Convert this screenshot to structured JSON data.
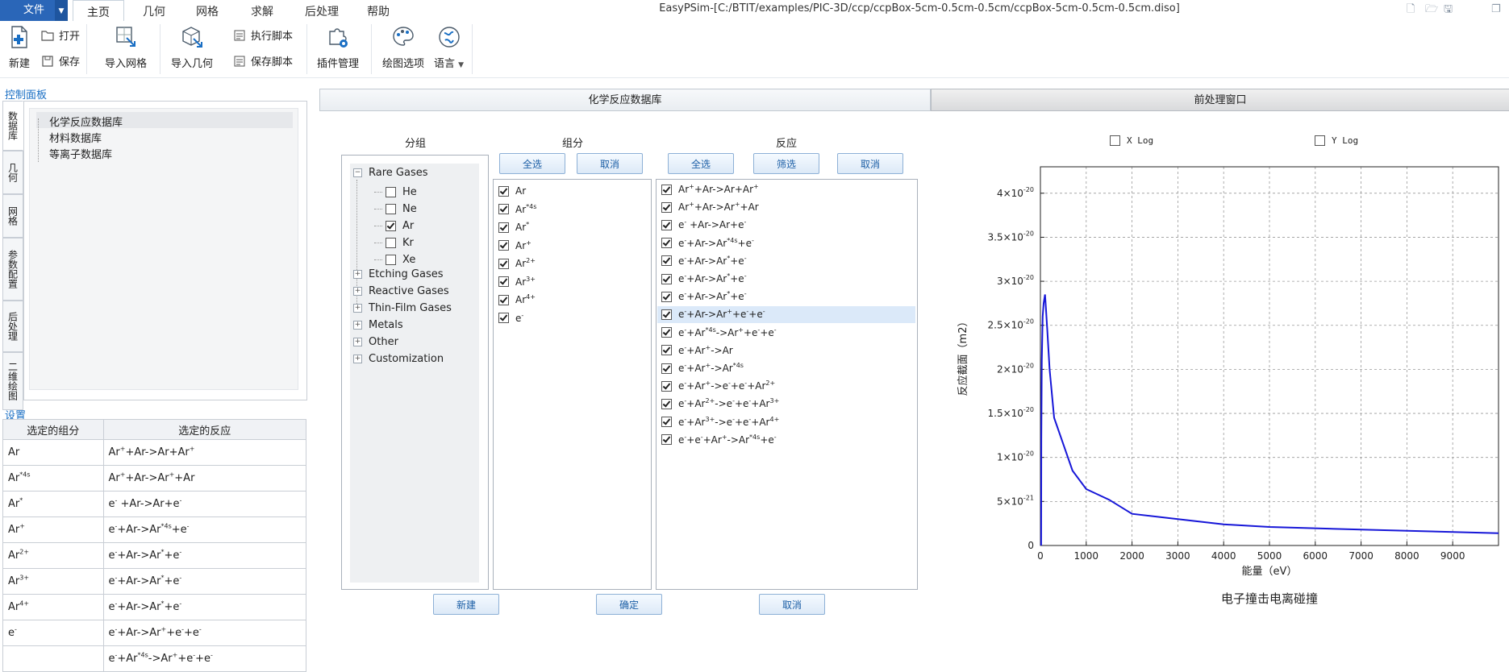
{
  "menu": {
    "file": "文件",
    "tabs": [
      "主页",
      "几何",
      "网格",
      "求解",
      "后处理",
      "帮助"
    ]
  },
  "window_title": "EasyPSim-[C:/BTIT/examples/PIC-3D/ccp/ccpBox-5cm-0.5cm-0.5cm/ccpBox-5cm-0.5cm-0.5cm.diso]",
  "toolbar": {
    "new": "新建",
    "open": "打开",
    "save": "保存",
    "import_mesh": "导入网格",
    "import_geometry": "导入几何",
    "run_script": "执行脚本",
    "save_script": "保存脚本",
    "plugin_manager": "插件管理",
    "plot_options": "绘图选项",
    "language": "语言"
  },
  "left_panel": {
    "title": "控制面板",
    "vtabs": [
      "数据库",
      "几何",
      "网格",
      "参数配置",
      "后处理",
      "二维绘图"
    ],
    "db_items": [
      "化学反应数据库",
      "材料数据库",
      "等离子数据库"
    ],
    "settings_title": "设置",
    "settings_headers": [
      "选定的组分",
      "选定的反应"
    ],
    "settings_components": [
      "Ar",
      "Ar^{*4s}",
      "Ar^{*}",
      "Ar^{+}",
      "Ar^{2+}",
      "Ar^{3+}",
      "Ar^{4+}",
      "e^{-}",
      ""
    ],
    "settings_reactions": [
      "Ar^{+}+Ar->Ar+Ar^{+}",
      "Ar^{+}+Ar->Ar^{+}+Ar",
      "e^{-} +Ar->Ar+e^{-}",
      "e^{-}+Ar->Ar^{*4s}+e^{-}",
      "e^{-}+Ar->Ar^{*}+e^{-}",
      "e^{-}+Ar->Ar^{*}+e^{-}",
      "e^{-}+Ar->Ar^{*}+e^{-}",
      "e^{-}+Ar->Ar^{+}+e^{-}+e^{-}",
      "e^{-}+Ar^{*4s}->Ar^{+}+e^{-}+e^{-}"
    ]
  },
  "center_tabs": [
    "化学反应数据库",
    "前处理窗口"
  ],
  "columns": {
    "group": "分组",
    "component": "组分",
    "reaction": "反应"
  },
  "group_tree": {
    "root": "Rare Gases",
    "children": [
      {
        "label": "He",
        "checked": false
      },
      {
        "label": "Ne",
        "checked": false
      },
      {
        "label": "Ar",
        "checked": true
      },
      {
        "label": "Kr",
        "checked": false
      },
      {
        "label": "Xe",
        "checked": false
      }
    ],
    "other_groups": [
      "Etching Gases",
      "Reactive Gases",
      "Thin-Film Gases",
      "Metals",
      "Other",
      "Customization"
    ]
  },
  "component_buttons": {
    "select_all": "全选",
    "cancel": "取消"
  },
  "components": [
    "Ar",
    "Ar^{*4s}",
    "Ar^{*}",
    "Ar^{+}",
    "Ar^{2+}",
    "Ar^{3+}",
    "Ar^{4+}",
    "e^{-}"
  ],
  "reaction_buttons": {
    "select_all": "全选",
    "filter": "筛选",
    "cancel": "取消"
  },
  "reactions": [
    "Ar^{+}+Ar->Ar+Ar^{+}",
    "Ar^{+}+Ar->Ar^{+}+Ar",
    "e^{-} +Ar->Ar+e^{-}",
    "e^{-}+Ar->Ar^{*4s}+e^{-}",
    "e^{-}+Ar->Ar^{*}+e^{-}",
    "e^{-}+Ar->Ar^{*}+e^{-}",
    "e^{-}+Ar->Ar^{*}+e^{-}",
    "e^{-}+Ar->Ar^{+}+e^{-}+e^{-}",
    "e^{-}+Ar^{*4s}->Ar^{+}+e^{-}+e^{-}",
    "e^{-}+Ar^{+}->Ar",
    "e^{-}+Ar^{+}->Ar^{*4s}",
    "e^{-}+Ar^{+}->e^{-}+e^{-}+Ar^{2+}",
    "e^{-}+Ar^{2+}->e^{-}+e^{-}+Ar^{3+}",
    "e^{-}+Ar^{3+}->e^{-}+e^{-}+Ar^{4+}",
    "e^{-}+e^{-}+Ar^{+}->Ar^{*4s}+e^{-}"
  ],
  "selected_reaction_index": 7,
  "bottom_buttons": {
    "new": "新建",
    "confirm": "确定",
    "cancel": "取消"
  },
  "chart_options": {
    "xlog": "X Log",
    "ylog": "Y Log",
    "xlog_checked": false,
    "ylog_checked": false
  },
  "colors": {
    "accent": "#2a66b8",
    "link_blue": "#1a6fc4",
    "series": "#1616d8",
    "selection": "#dbe9f9"
  },
  "chart_data": {
    "type": "line",
    "title": "电子撞击电离碰撞",
    "xlabel": "能量（eV）",
    "ylabel": "反应截面（m2）",
    "xlim": [
      0,
      10000
    ],
    "ylim": [
      0,
      4.3e-20
    ],
    "xticks": [
      0,
      1000,
      2000,
      3000,
      4000,
      5000,
      6000,
      7000,
      8000,
      9000
    ],
    "yticks": [
      0,
      5e-21,
      1e-20,
      1.5e-20,
      2e-20,
      2.5e-20,
      3e-20,
      3.5e-20,
      4e-20
    ],
    "ytick_labels": [
      "0",
      "5×10^{-21}",
      "1×10^{-20}",
      "1.5×10^{-20}",
      "2×10^{-20}",
      "2.5×10^{-20}",
      "3×10^{-20}",
      "3.5×10^{-20}",
      "4×10^{-20}"
    ],
    "grid": true,
    "series": [
      {
        "x": [
          15.8,
          20,
          30,
          50,
          70,
          100,
          120,
          150,
          200,
          300,
          500,
          700,
          1000,
          1500,
          2000,
          3000,
          4000,
          5000,
          7000,
          10000
        ],
        "y": [
          0,
          1.2e-20,
          2.1e-20,
          2.6e-20,
          2.75e-20,
          2.85e-20,
          2.7e-20,
          2.45e-20,
          2e-20,
          1.45e-20,
          1.15e-20,
          8.5e-21,
          6.4e-21,
          5.2e-21,
          3.6e-21,
          3e-21,
          2.4e-21,
          2.1e-21,
          1.8e-21,
          1.4e-21
        ]
      }
    ]
  }
}
